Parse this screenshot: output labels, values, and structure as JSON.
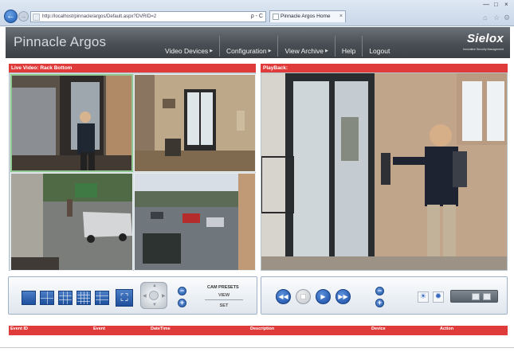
{
  "browser": {
    "address": "http://localhost/pinnacle/argos/Default.aspx?DVRID=2",
    "address_tools": "ρ - C",
    "tab_title": "Pinnacle Argos Home",
    "tab_close": "×",
    "window_minimize": "—",
    "window_maximize": "□",
    "window_close": "×",
    "back": "←",
    "forward": "→",
    "toolbar_icons": [
      "⌂",
      "☆",
      "⚙"
    ]
  },
  "app": {
    "title": "Pinnacle Argos",
    "brand": "Sielox",
    "brand_tagline": "Innovative Security Management"
  },
  "nav": {
    "items": [
      {
        "label": "Video Devices",
        "has_menu": true
      },
      {
        "label": "Configuration",
        "has_menu": true
      },
      {
        "label": "View Archive",
        "has_menu": true
      },
      {
        "label": "Help",
        "has_menu": false
      },
      {
        "label": "Logout",
        "has_menu": false
      }
    ]
  },
  "live": {
    "header": "Live Video: Rack Bottom"
  },
  "playback": {
    "header": "PlayBack:"
  },
  "controls": {
    "cam_presets": "CAM PRESETS",
    "view": "VIEW",
    "set": "SET",
    "zoom_minus": "−",
    "zoom_plus": "+",
    "fullscreen": "⛶"
  },
  "playback_controls": {
    "rewind": "◀◀",
    "play": "▶",
    "fast_forward": "▶▶",
    "speed_minus": "−",
    "speed_plus": "+",
    "brightness": "☀",
    "contrast": "✹"
  },
  "events": {
    "columns": [
      "Event ID",
      "Event",
      "DateTime",
      "Description",
      "Device",
      "Action"
    ]
  },
  "colors": {
    "accent_red": "#df3b3b",
    "header_gray": "#4a4f55",
    "button_blue": "#1d4f9d"
  }
}
